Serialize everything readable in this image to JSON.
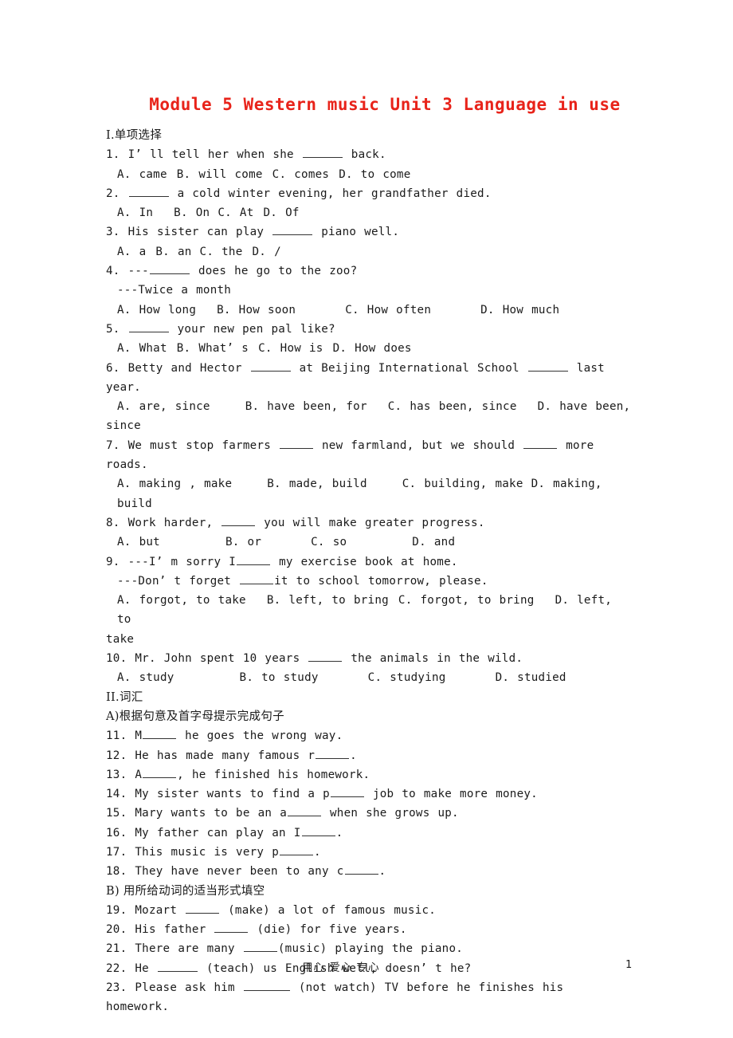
{
  "document": {
    "title": "Module 5 Western music Unit 3 Language in use",
    "title_color": "#e8231a"
  },
  "sections": {
    "part1_heading": "I.单项选择",
    "part2_heading": "II.词汇",
    "part2a_heading": "A)根据句意及首字母提示完成句子",
    "part2b_heading": "B) 用所给动词的适当形式填空"
  },
  "q1": {
    "stem_a": "1. I’ ll tell her when she",
    "stem_b": "back.",
    "opt_a": "A. came",
    "opt_b": "B. will come",
    "opt_c": "C. comes",
    "opt_d": "D. to come"
  },
  "q2": {
    "stem_a": "2.",
    "stem_b": "a cold winter evening, her grandfather died.",
    "opt_a": "A. In",
    "opt_b": "B. On",
    "opt_c": "C. At",
    "opt_d": "D. Of"
  },
  "q3": {
    "stem_a": "3. His sister can play",
    "stem_b": "piano well.",
    "opt_a": "A. a",
    "opt_b": "B. an",
    "opt_c": "C. the",
    "opt_d": "D. /"
  },
  "q4": {
    "stem_a": "4. ---",
    "stem_b": "does he go to the zoo?",
    "stem_c": "---Twice a month",
    "opt_a": "A. How long",
    "opt_b": "B. How soon",
    "opt_c": "C. How often",
    "opt_d": "D. How much"
  },
  "q5": {
    "stem_a": "5.",
    "stem_b": "your new pen pal like?",
    "opt_a": "A. What",
    "opt_b": "B. What’ s",
    "opt_c": "C. How is",
    "opt_d": "D. How does"
  },
  "q6": {
    "stem_a": "6. Betty and Hector",
    "stem_b": "at Beijing International School",
    "stem_c": "last year.",
    "opt_a": "A. are, since",
    "opt_b": "B. have been, for",
    "opt_c": "C. has been, since",
    "opt_d": "D. have been,",
    "opt_d_wrap": "since"
  },
  "q7": {
    "stem_a": "7. We must stop farmers",
    "stem_b": "new farmland, but we should",
    "stem_c": "more roads.",
    "opt_a": "A. making , make",
    "opt_b": "B. made, build",
    "opt_c": "C. building, make",
    "opt_d": "D. making, build"
  },
  "q8": {
    "stem_a": "8. Work harder,",
    "stem_b": "you will make greater progress.",
    "opt_a": "A. but",
    "opt_b": "B. or",
    "opt_c": "C. so",
    "opt_d": "D. and"
  },
  "q9": {
    "stem_a": "9. ---I’ m sorry I",
    "stem_b": "my exercise book at home.",
    "stem_c": "---Don’ t forget",
    "stem_d": "it to school tomorrow, please.",
    "opt_a": "A. forgot, to take",
    "opt_b": "B. left, to bring",
    "opt_c": "C. forgot, to bring",
    "opt_d": "D. left, to",
    "opt_d_wrap": "take"
  },
  "q10": {
    "stem_a": "10. Mr. John spent 10 years",
    "stem_b": "the animals in the wild.",
    "opt_a": "A. study",
    "opt_b": "B. to study",
    "opt_c": "C. studying",
    "opt_d": "D. studied"
  },
  "q11": {
    "stem_a": "11. M",
    "stem_b": "he goes the wrong way."
  },
  "q12": {
    "stem_a": "12. He has made many famous r",
    "stem_b": "."
  },
  "q13": {
    "stem_a": "13. A",
    "stem_b": ", he finished his homework."
  },
  "q14": {
    "stem_a": "14. My sister wants to find a p",
    "stem_b": "job to make more money."
  },
  "q15": {
    "stem_a": "15. Mary wants to be an a",
    "stem_b": "when she grows up."
  },
  "q16": {
    "stem_a": "16. My father can play an I",
    "stem_b": "."
  },
  "q17": {
    "stem_a": "17. This music is very p",
    "stem_b": "."
  },
  "q18": {
    "stem_a": "18. They have never been to any c",
    "stem_b": "."
  },
  "q19": {
    "stem_a": "19. Mozart",
    "stem_b": "(make) a lot of famous music."
  },
  "q20": {
    "stem_a": "20. His father",
    "stem_b": "(die) for five years."
  },
  "q21": {
    "stem_a": "21. There are many",
    "stem_b": "(music) playing the piano."
  },
  "q22": {
    "stem_a": "22. He",
    "stem_b": "(teach) us English well, doesn’ t he?"
  },
  "q23": {
    "stem_a": "23. Please ask him",
    "stem_b": "(not watch) TV before he finishes his homework."
  },
  "footer": {
    "center_text": "用心  爱心  专心",
    "page_number": "1"
  }
}
